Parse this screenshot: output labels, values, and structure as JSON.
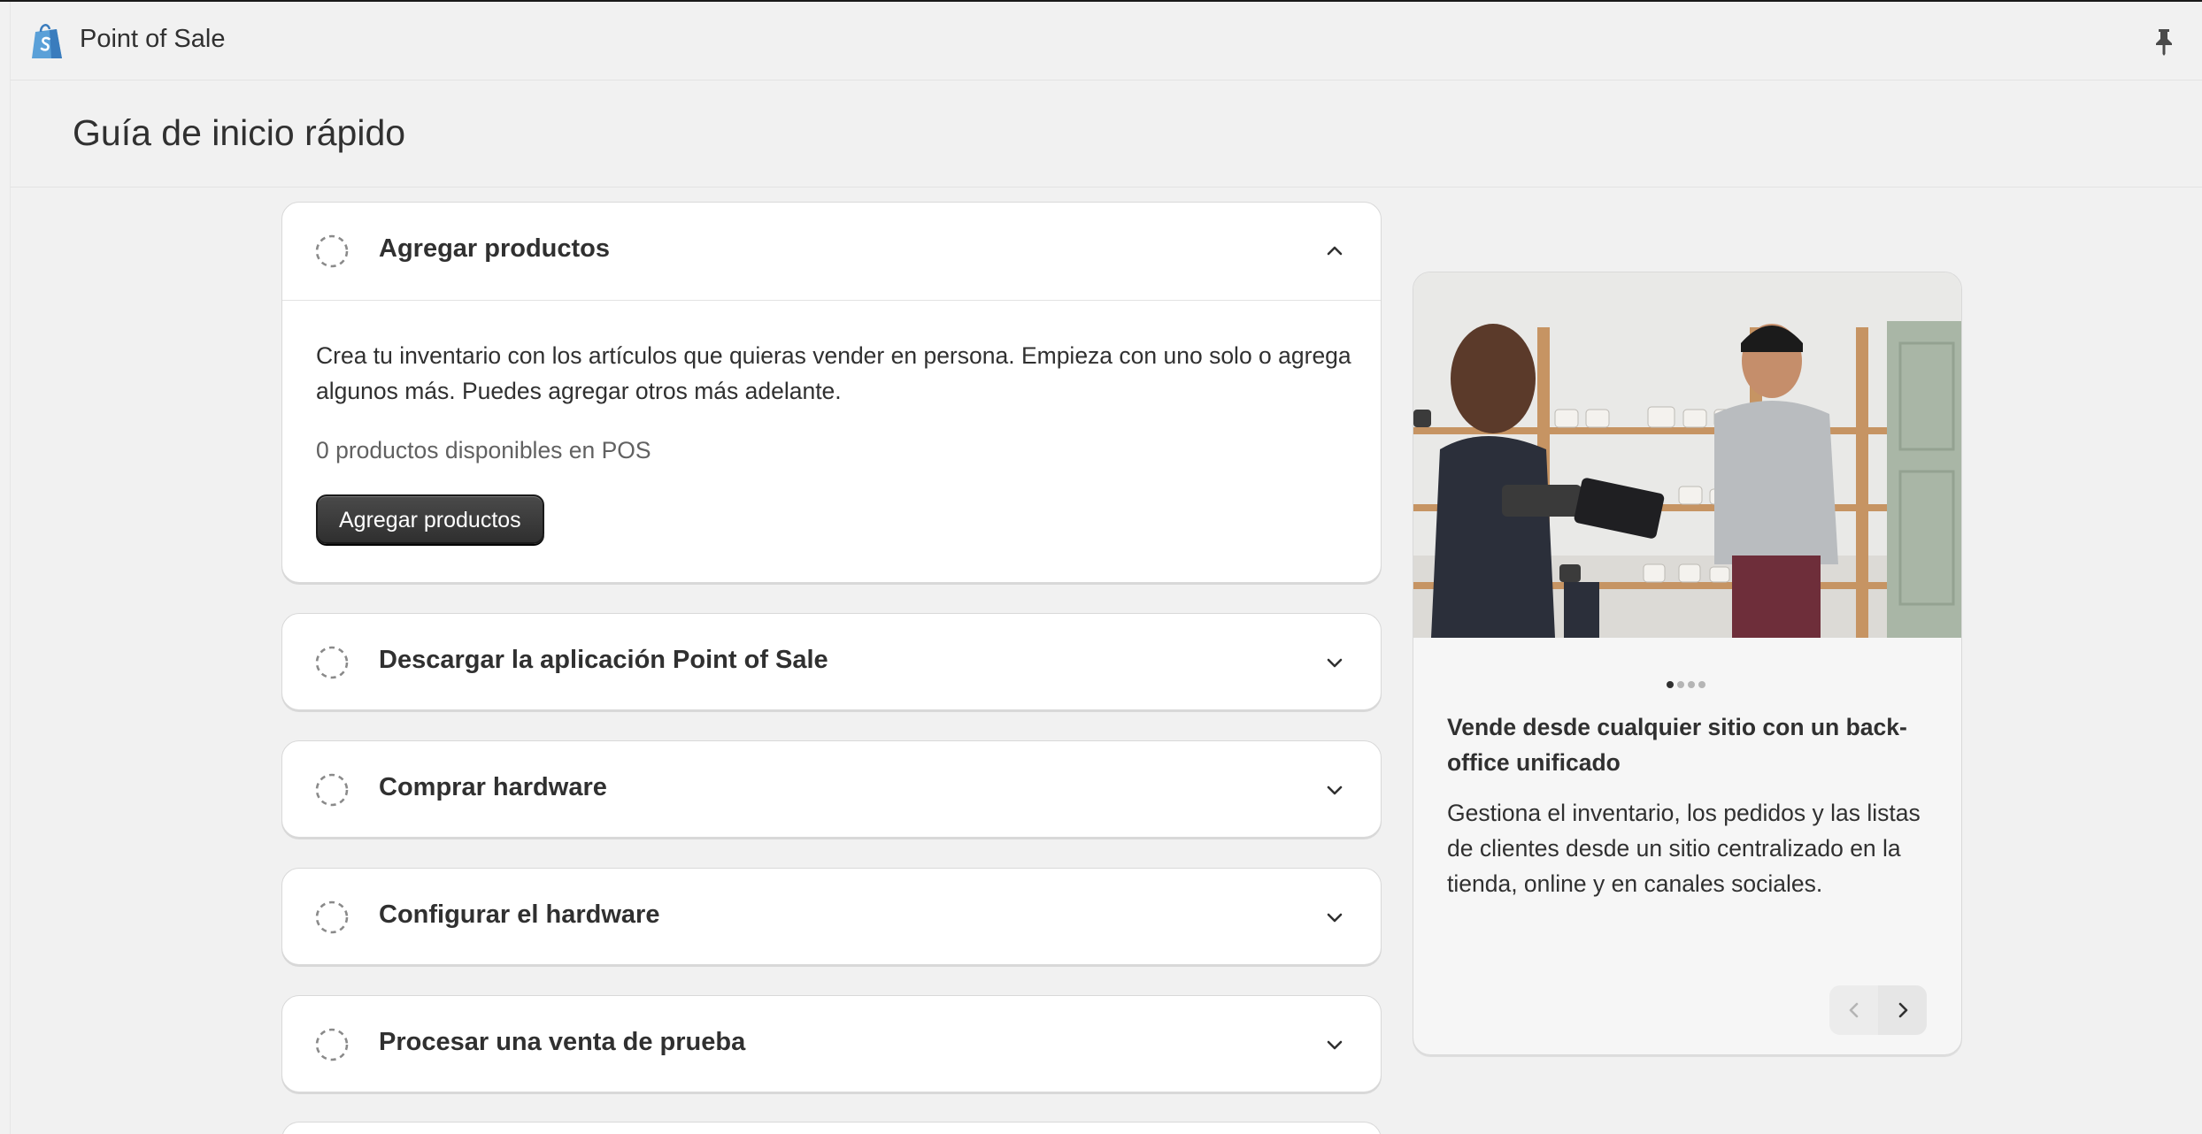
{
  "app": {
    "title": "Point of Sale"
  },
  "page": {
    "title": "Guía de inicio rápido"
  },
  "steps": [
    {
      "title": "Agregar productos",
      "expanded": true,
      "description": "Crea tu inventario con los artículos que quieras vender en persona. Empieza con uno solo o agrega algunos más. Puedes agregar otros más adelante.",
      "status": "0 productos disponibles en POS",
      "button_label": "Agregar productos"
    },
    {
      "title": "Descargar la aplicación Point of Sale",
      "expanded": false
    },
    {
      "title": "Comprar hardware",
      "expanded": false
    },
    {
      "title": "Configurar el hardware",
      "expanded": false
    },
    {
      "title": "Procesar una venta de prueba",
      "expanded": false
    }
  ],
  "promo": {
    "title": "Vende desde cualquier sitio con un back-office unificado",
    "text": "Gestiona el inventario, los pedidos y las listas de clientes desde un sitio centralizado en la tienda, online y en canales sociales.",
    "slides_total": 4,
    "slide_active": 1
  },
  "icons": {
    "logo": "shopify-bag-icon",
    "pin": "pin-icon",
    "step": "dashed-circle-icon",
    "expand": "chevron-down-icon",
    "collapse": "chevron-up-icon",
    "prev": "chevron-left-icon",
    "next": "chevron-right-icon"
  },
  "colors": {
    "brand": "#5e8e3e",
    "primary_button": "#303030"
  }
}
